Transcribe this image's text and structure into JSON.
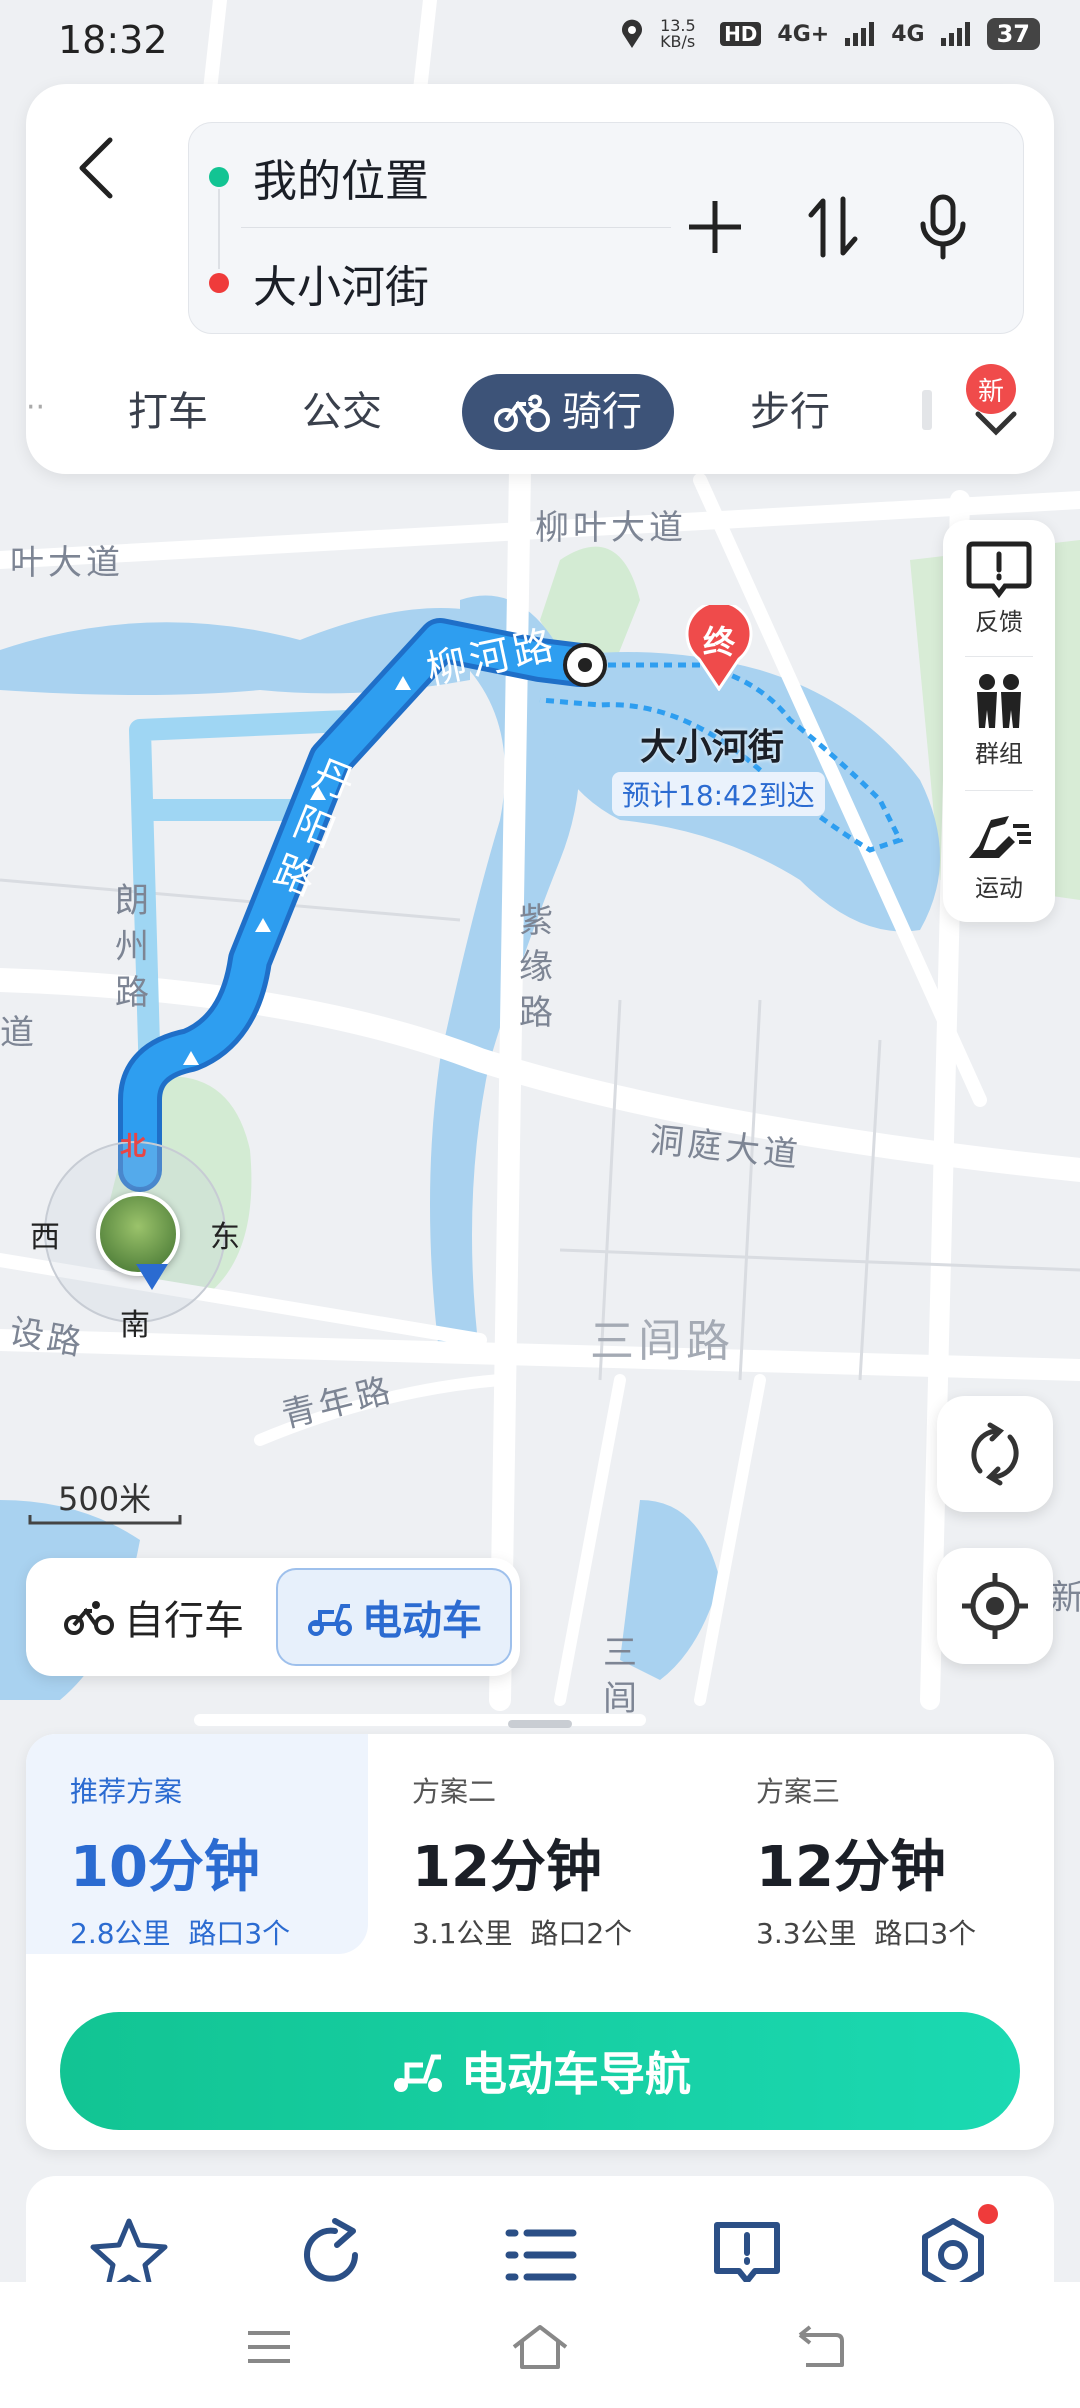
{
  "status_bar": {
    "time": "18:32",
    "net_speed": "13.5 KB/s",
    "hd": "HD",
    "signal1": "4G+",
    "signal2": "4G",
    "battery": "37"
  },
  "search": {
    "origin": "我的位置",
    "destination": "大小河街"
  },
  "modes": [
    {
      "label": "打车"
    },
    {
      "label": "公交"
    },
    {
      "label": "骑行"
    },
    {
      "label": "步行"
    }
  ],
  "new_badge": "新",
  "map": {
    "roads": {
      "liuye_top": "柳叶大道",
      "liuye_left": "叶大道",
      "liuhe": "柳河路",
      "danyang": "丹阳路",
      "langzhou": "朗州路",
      "ziyuan": "紫缘路",
      "dongting": "洞庭大道",
      "sanlv": "三闾路",
      "sanlv_v": "三闾",
      "qingnian": "青年路",
      "shelu": "设路",
      "dao_left": "道",
      "xin_right": "新"
    },
    "destination_label": "大小河街",
    "end_marker": "终",
    "eta": "预计18:42到达",
    "compass": {
      "north": "北",
      "south": "南",
      "east": "东",
      "west": "西"
    },
    "scale": "500米"
  },
  "side_panel": [
    {
      "label": "反馈",
      "icon": "feedback-icon"
    },
    {
      "label": "群组",
      "icon": "group-icon"
    },
    {
      "label": "运动",
      "icon": "sport-icon"
    }
  ],
  "vehicle": {
    "bicycle": "自行车",
    "ebike": "电动车"
  },
  "plans": [
    {
      "tag": "推荐方案",
      "time": "10分钟",
      "detail": "2.8公里  路口3个"
    },
    {
      "tag": "方案二",
      "time": "12分钟",
      "detail": "3.1公里  路口2个"
    },
    {
      "tag": "方案三",
      "time": "12分钟",
      "detail": "3.3公里  路口3个"
    }
  ],
  "nav_button": "电动车导航",
  "colors": {
    "route": "#2e9ef0",
    "route_alt": "#9fd6f3",
    "nav_green": "#12c493",
    "tab_active": "#3d5378",
    "accent_blue": "#2b6bd1"
  }
}
